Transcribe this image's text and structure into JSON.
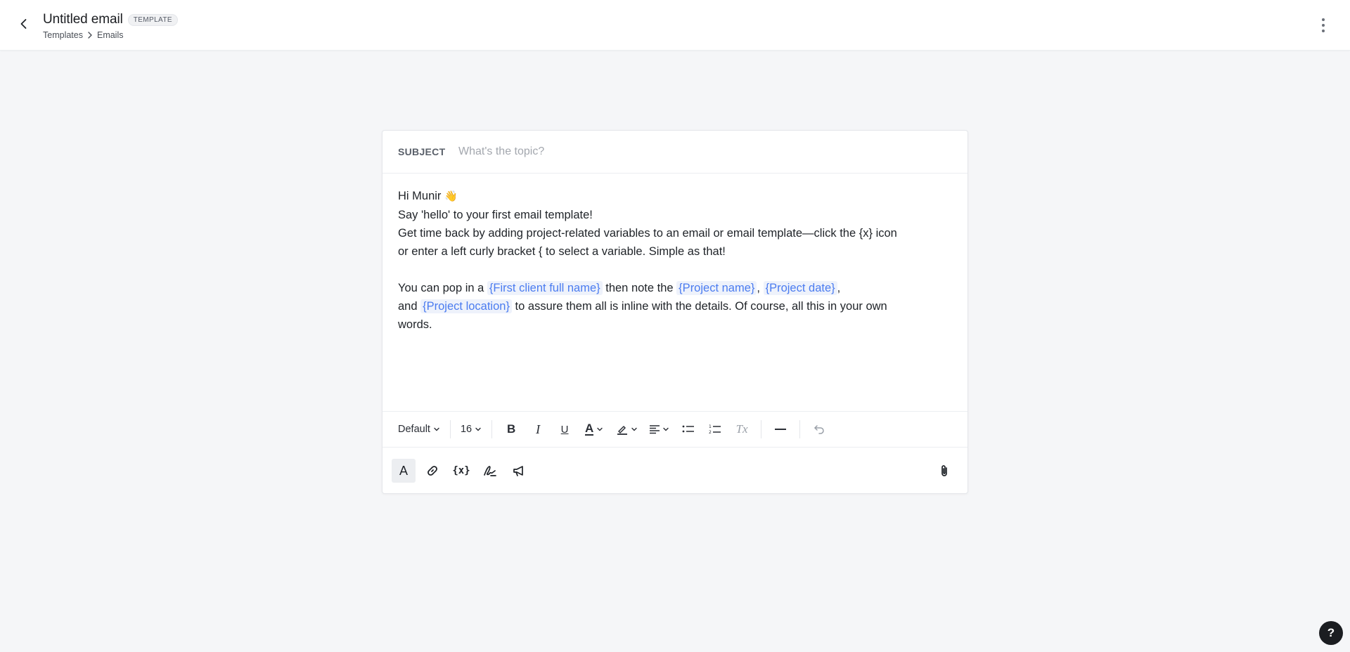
{
  "header": {
    "title": "Untitled email",
    "badge": "TEMPLATE",
    "breadcrumb": [
      "Templates",
      "Emails"
    ]
  },
  "editor": {
    "subject_label": "SUBJECT",
    "subject_placeholder": "What's the topic?",
    "subject_value": "",
    "body": {
      "greeting": "Hi Munir",
      "greeting_emoji": "👋",
      "line2": "Say 'hello' to your first email template!",
      "line3": "Get time back by adding project-related variables to an email or email template—click the {x} icon",
      "line4": "or enter a left curly bracket { to select a variable. Simple as that!",
      "para2": {
        "t1": "You can pop in a ",
        "v1": "{First client full name}",
        "t2": " then note the ",
        "v2": "{Project name}",
        "t3": ", ",
        "v3": "{Project date}",
        "t4": ",",
        "t5": "and ",
        "v4": "{Project location}",
        "t6": " to assure them all is inline with the details. Of course, all this in your own",
        "t7": "words."
      }
    },
    "toolbar": {
      "font_family": "Default",
      "font_size": "16",
      "bold": "B",
      "italic": "I",
      "underline": "U",
      "text_color": "A",
      "clear_format": "Tx"
    },
    "bottom_toolbar": {
      "text_format": "A",
      "variable": "{x}"
    }
  },
  "help": {
    "label": "?"
  },
  "colors": {
    "variable": "#4b7cf0",
    "background": "#f5f6f8"
  }
}
